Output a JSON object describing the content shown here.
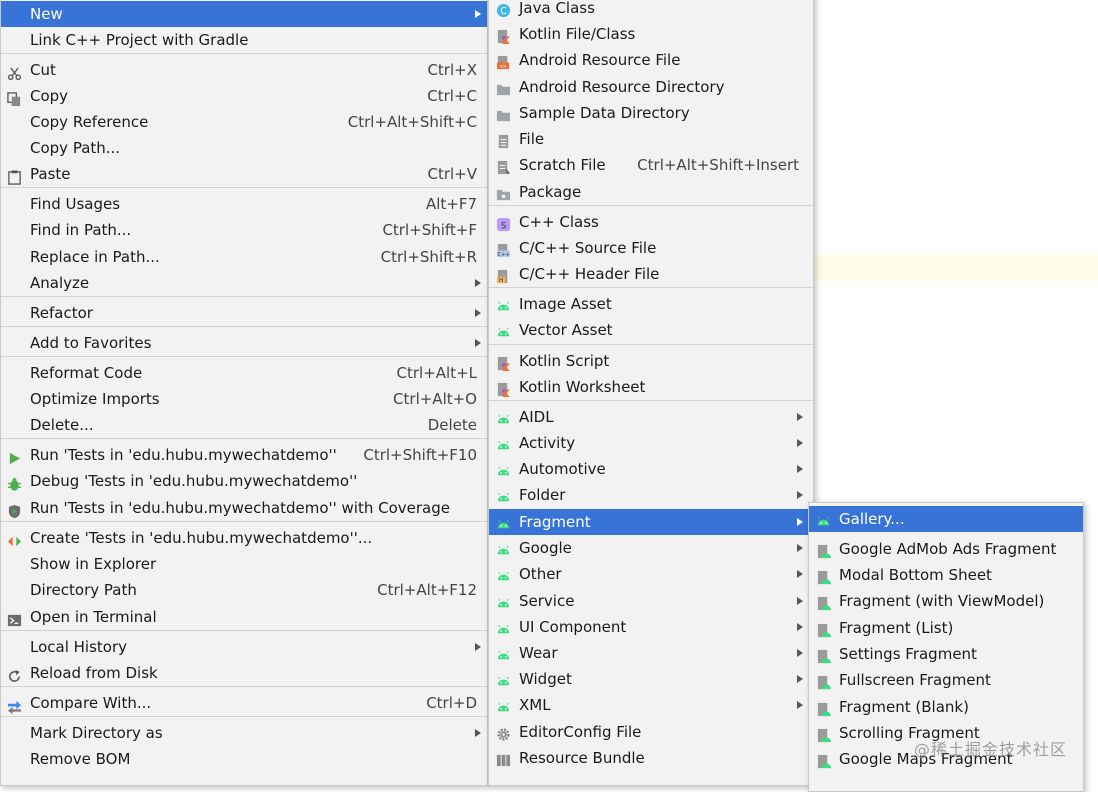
{
  "main_menu": {
    "items": [
      {
        "label": "New",
        "arrow": true,
        "highlight": true
      },
      {
        "label": "Link C++ Project with Gradle"
      },
      {
        "label": "Cut",
        "shortcut": "Ctrl+X",
        "icon": "scissors-icon"
      },
      {
        "label": "Copy",
        "shortcut": "Ctrl+C",
        "icon": "copy-icon"
      },
      {
        "label": "Copy Reference",
        "shortcut": "Ctrl+Alt+Shift+C"
      },
      {
        "label": "Copy Path..."
      },
      {
        "label": "Paste",
        "shortcut": "Ctrl+V",
        "icon": "clipboard-icon"
      },
      {
        "label": "Find Usages",
        "shortcut": "Alt+F7"
      },
      {
        "label": "Find in Path...",
        "shortcut": "Ctrl+Shift+F"
      },
      {
        "label": "Replace in Path...",
        "shortcut": "Ctrl+Shift+R"
      },
      {
        "label": "Analyze",
        "arrow": true
      },
      {
        "label": "Refactor",
        "arrow": true
      },
      {
        "label": "Add to Favorites",
        "arrow": true
      },
      {
        "label": "Reformat Code",
        "shortcut": "Ctrl+Alt+L"
      },
      {
        "label": "Optimize Imports",
        "shortcut": "Ctrl+Alt+O"
      },
      {
        "label": "Delete...",
        "shortcut": "Delete"
      },
      {
        "label": "Run 'Tests in 'edu.hubu.mywechatdemo''",
        "shortcut": "Ctrl+Shift+F10",
        "icon": "run-icon"
      },
      {
        "label": "Debug 'Tests in 'edu.hubu.mywechatdemo''",
        "icon": "debug-icon"
      },
      {
        "label": "Run 'Tests in 'edu.hubu.mywechatdemo'' with Coverage",
        "icon": "coverage-icon"
      },
      {
        "label": "Create 'Tests in 'edu.hubu.mywechatdemo''...",
        "icon": "create-config-icon"
      },
      {
        "label": "Show in Explorer"
      },
      {
        "label": "Directory Path",
        "shortcut": "Ctrl+Alt+F12"
      },
      {
        "label": "Open in Terminal",
        "icon": "terminal-icon"
      },
      {
        "label": "Local History",
        "arrow": true
      },
      {
        "label": "Reload from Disk",
        "icon": "reload-icon"
      },
      {
        "label": "Compare With...",
        "shortcut": "Ctrl+D",
        "icon": "compare-icon"
      },
      {
        "label": "Mark Directory as",
        "arrow": true
      },
      {
        "label": "Remove BOM"
      }
    ]
  },
  "new_menu": {
    "items": [
      {
        "label": "Java Class",
        "icon": "java-class-icon"
      },
      {
        "label": "Kotlin File/Class",
        "icon": "kotlin-file-icon"
      },
      {
        "label": "Android Resource File",
        "icon": "android-resource-file-icon"
      },
      {
        "label": "Android Resource Directory",
        "icon": "folder-icon"
      },
      {
        "label": "Sample Data Directory",
        "icon": "folder-icon"
      },
      {
        "label": "File",
        "icon": "file-icon"
      },
      {
        "label": "Scratch File",
        "shortcut": "Ctrl+Alt+Shift+Insert",
        "icon": "scratch-file-icon"
      },
      {
        "label": "Package",
        "icon": "package-icon"
      },
      {
        "label": "C++ Class",
        "icon": "cpp-class-icon"
      },
      {
        "label": "C/C++ Source File",
        "icon": "cpp-source-icon"
      },
      {
        "label": "C/C++ Header File",
        "icon": "cpp-header-icon"
      },
      {
        "label": "Image Asset",
        "icon": "android-icon"
      },
      {
        "label": "Vector Asset",
        "icon": "android-icon"
      },
      {
        "label": "Kotlin Script",
        "icon": "kotlin-script-icon"
      },
      {
        "label": "Kotlin Worksheet",
        "icon": "kotlin-worksheet-icon"
      },
      {
        "label": "AIDL",
        "arrow": true,
        "icon": "android-icon"
      },
      {
        "label": "Activity",
        "arrow": true,
        "icon": "android-icon"
      },
      {
        "label": "Automotive",
        "arrow": true,
        "icon": "android-icon"
      },
      {
        "label": "Folder",
        "arrow": true,
        "icon": "android-icon"
      },
      {
        "label": "Fragment",
        "arrow": true,
        "highlight": true,
        "icon": "android-icon"
      },
      {
        "label": "Google",
        "arrow": true,
        "icon": "android-icon"
      },
      {
        "label": "Other",
        "arrow": true,
        "icon": "android-icon"
      },
      {
        "label": "Service",
        "arrow": true,
        "icon": "android-icon"
      },
      {
        "label": "UI Component",
        "arrow": true,
        "icon": "android-icon"
      },
      {
        "label": "Wear",
        "arrow": true,
        "icon": "android-icon"
      },
      {
        "label": "Widget",
        "arrow": true,
        "icon": "android-icon"
      },
      {
        "label": "XML",
        "arrow": true,
        "icon": "android-icon"
      },
      {
        "label": "EditorConfig File",
        "icon": "gear-icon"
      },
      {
        "label": "Resource Bundle",
        "icon": "resource-bundle-icon"
      }
    ]
  },
  "fragment_menu": {
    "items": [
      {
        "label": "Gallery...",
        "highlight": true,
        "icon": "android-icon"
      },
      {
        "label": "Google AdMob Ads Fragment",
        "icon": "template-icon"
      },
      {
        "label": "Modal Bottom Sheet",
        "icon": "template-icon"
      },
      {
        "label": "Fragment (with ViewModel)",
        "icon": "template-icon"
      },
      {
        "label": "Fragment (List)",
        "icon": "template-icon"
      },
      {
        "label": "Settings Fragment",
        "icon": "template-icon"
      },
      {
        "label": "Fullscreen Fragment",
        "icon": "template-icon"
      },
      {
        "label": "Fragment (Blank)",
        "icon": "template-icon"
      },
      {
        "label": "Scrolling Fragment",
        "icon": "template-icon"
      },
      {
        "label": "Google Maps Fragment",
        "icon": "template-icon"
      }
    ]
  },
  "watermark": "@稀土掘金技术社区",
  "colors": {
    "highlight": "#3874d8",
    "android_green": "#3ddc84",
    "menu_bg": "#f2f2f2"
  }
}
